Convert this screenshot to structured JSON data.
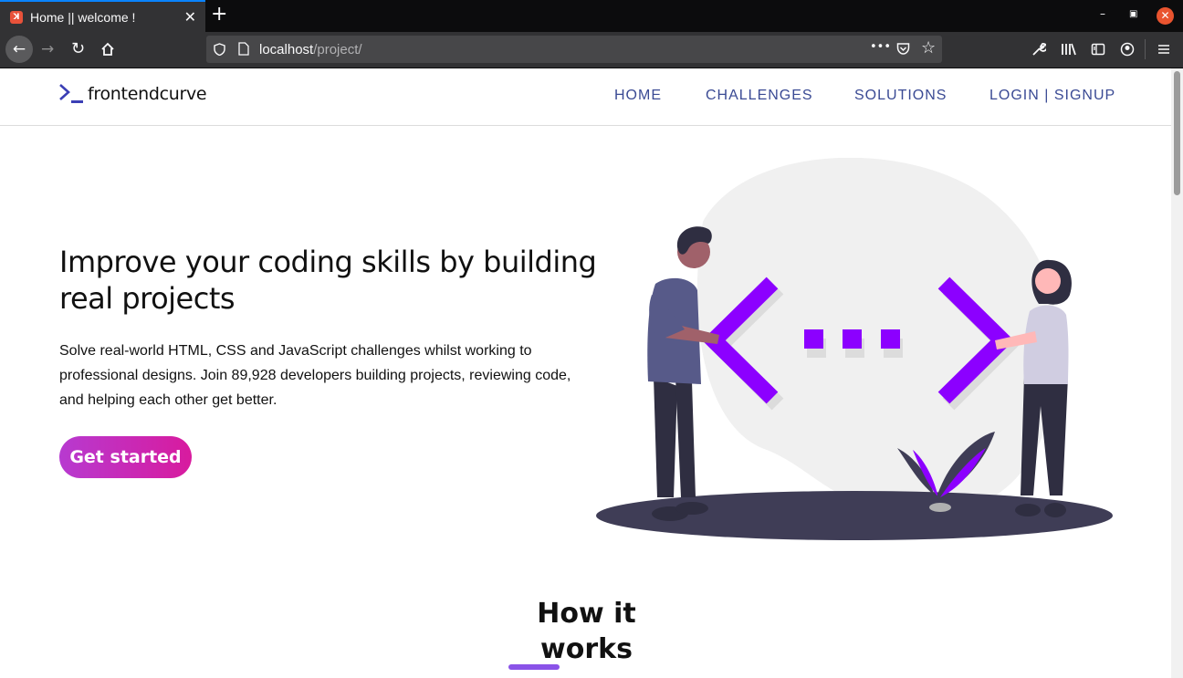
{
  "browser": {
    "tab_title": "Home || welcome !",
    "tab_close": "✕",
    "new_tab": "+",
    "url_host": "localhost",
    "url_path": "/project/",
    "page_actions": "•••"
  },
  "site": {
    "logo_text": "frontendcurve",
    "nav": [
      "HOME",
      "CHALLENGES",
      "SOLUTIONS",
      "LOGIN | SIGNUP"
    ]
  },
  "hero": {
    "title": "Improve your coding skills by building real projects",
    "text": "Solve real-world HTML, CSS and JavaScript challenges whilst working to professional designs. Join 89,928 developers building projects, reviewing code, and helping each other get better.",
    "cta": "Get started"
  },
  "how": {
    "title": "How it works"
  },
  "colors": {
    "accent_purple": "#8c00ff",
    "nav_blue": "#3a4a94",
    "cta_start": "#b73ad0",
    "cta_end": "#d81b9e"
  },
  "icons": [
    "xampp-favicon",
    "back-arrow-icon",
    "forward-arrow-icon",
    "reload-icon",
    "home-icon",
    "shield-icon",
    "page-icon",
    "pocket-icon",
    "star-icon",
    "wrench-icon",
    "library-icon",
    "sidebar-icon",
    "account-icon",
    "menu-icon"
  ]
}
